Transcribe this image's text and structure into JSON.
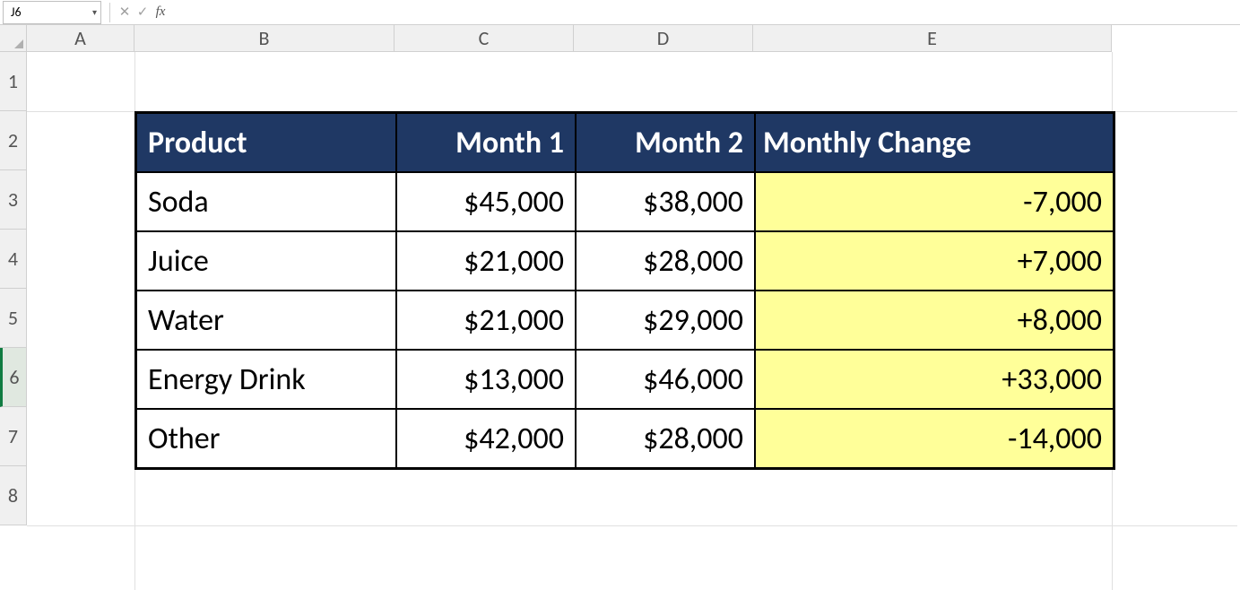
{
  "formula_bar": {
    "active_cell": "J6",
    "formula_value": ""
  },
  "columns": {
    "A": "A",
    "B": "B",
    "C": "C",
    "D": "D",
    "E": "E"
  },
  "rows": {
    "r1": "1",
    "r2": "2",
    "r3": "3",
    "r4": "4",
    "r5": "5",
    "r6": "6",
    "r7": "7",
    "r8": "8"
  },
  "table": {
    "headers": {
      "product": "Product",
      "month1": "Month 1",
      "month2": "Month 2",
      "change": "Monthly Change"
    },
    "rows": [
      {
        "product": "Soda",
        "month1": "$45,000",
        "month2": "$38,000",
        "change": "-7,000"
      },
      {
        "product": "Juice",
        "month1": "$21,000",
        "month2": "$28,000",
        "change": "+7,000"
      },
      {
        "product": "Water",
        "month1": "$21,000",
        "month2": "$29,000",
        "change": "+8,000"
      },
      {
        "product": "Energy Drink",
        "month1": "$13,000",
        "month2": "$46,000",
        "change": "+33,000"
      },
      {
        "product": "Other",
        "month1": "$42,000",
        "month2": "$28,000",
        "change": "-14,000"
      }
    ]
  },
  "colors": {
    "header_bg": "#1f3864",
    "highlight": "#ffff99"
  }
}
